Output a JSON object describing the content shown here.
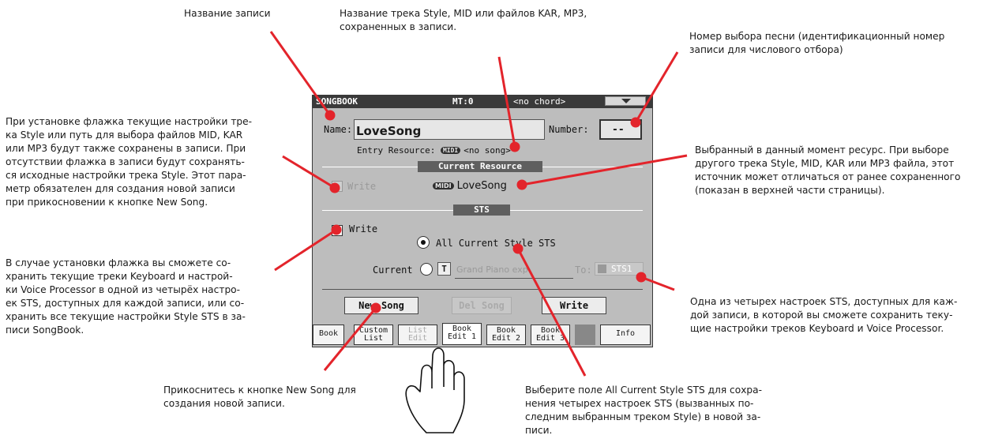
{
  "callouts": {
    "entry_name": "Название записи",
    "track_name": "Название трека Style, MID или файлов KAR, MP3,\nсохраненных в записи.",
    "song_number": "Номер выбора песни (идентификационный номер\nзаписи для числового отбора)",
    "resource_write": "При установке флажка текущие настройки тре-\nка Style или путь для выбора файлов MID, KAR\nили MP3 будут также сохранены в записи. При\nотсутствии флажка в записи будут сохранять-\nся исходные настройки трека Style.  Этот пара-\nметр обязателен для создания новой записи\nпри прикосновении к кнопке New Song.",
    "current_resource": "Выбранный в данный момент ресурс.  При выборе\nдругого трека Style, MID, KAR или MP3 файла, этот\nисточник может отличаться от ранее сохраненного\n(показан в верхней части страницы).",
    "sts_write": "В случае установки флажка вы сможете со-\nхранить текущие треки Keyboard и настрой-\nки Voice Processor в одной из четырёх настро-\nек STS, доступных для каждой записи, или со-\nхранить все текущие настройки Style STS в за-\nписи SongBook.",
    "sts_slot": "Одна из четырех настроек STS, доступных для каж-\nдой записи, в которой вы сможете сохранить теку-\nщие настройки треков Keyboard и Voice Processor.",
    "new_song": "Прикоснитесь к кнопке New Song для\nсоздания новой записи.",
    "all_current": "Выберите поле All Current Style STS для сохра-\nнения четырех настроек STS (вызванных по-\nследним выбранным треком Style) в новой за-\nписи."
  },
  "panel": {
    "title": "SONGBOOK",
    "mt": "MT:0",
    "chord": "<no chord>",
    "name_label": "Name:",
    "name_value": "LoveSong",
    "number_label": "Number:",
    "number_value": "--",
    "entry_resource_label": "Entry Resource:",
    "midi_badge": "MIDI",
    "entry_resource_value": "<no song>",
    "current_resource_header": "Current Resource",
    "resource_write_label": "Write",
    "current_resource_value": "LoveSong",
    "sts_header": "STS",
    "sts_write_label": "Write",
    "all_current_label": "All Current Style STS",
    "current_label": "Current",
    "t_icon_label": "T",
    "sound_name": "Grand Piano exp",
    "to_label": "To:",
    "sts_slot_value": "STS1",
    "buttons": {
      "new_song": "New Song",
      "del_song": "Del Song",
      "write": "Write"
    },
    "tabs": [
      {
        "label": "Book"
      },
      {
        "label": "Custom\nList"
      },
      {
        "label": "List\nEdit"
      },
      {
        "label": "Book\nEdit 1"
      },
      {
        "label": "Book\nEdit 2"
      },
      {
        "label": "Book\nEdit 3"
      },
      {
        "label": "Info"
      }
    ]
  },
  "colors": {
    "callout_line": "#e3242b",
    "panel_bg": "#bdbdbd",
    "title_bar": "#3a3a3a",
    "check_mark": "#7a1010"
  }
}
